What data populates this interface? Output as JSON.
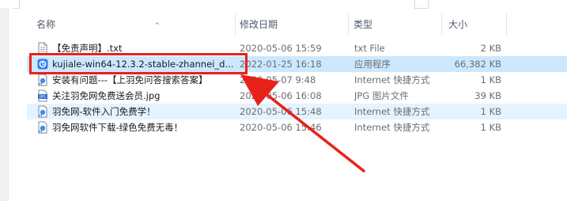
{
  "header": {
    "name": "名称",
    "date": "修改日期",
    "type": "类型",
    "size": "大小"
  },
  "files": [
    {
      "name": "【免责声明】.txt",
      "date": "2020-05-06 15:59",
      "type": "txt File",
      "size": "2 KB",
      "icon": "text-file-icon"
    },
    {
      "name": "kujiale-win64-12.3.2-stable-zhannei_d...",
      "date": "2022-01-25 16:18",
      "type": "应用程序",
      "size": "66,382 KB",
      "icon": "app-exe-icon"
    },
    {
      "name": "安装有问题---【上羽免问答搜索答案】",
      "date": "2020-05-07 9:48",
      "type": "Internet 快捷方式",
      "size": "1 KB",
      "icon": "internet-shortcut-icon"
    },
    {
      "name": "关注羽免网免费送会员.jpg",
      "date": "2020-05-06 16:08",
      "type": "JPG 图片文件",
      "size": "39 KB",
      "icon": "jpg-image-icon"
    },
    {
      "name": "羽免网-软件入门免费学！",
      "date": "2020-05-06 15:48",
      "type": "Internet 快捷方式",
      "size": "1 KB",
      "icon": "internet-shortcut-icon"
    },
    {
      "name": "羽免网软件下载-绿色免费无毒！",
      "date": "2020-05-06 15:46",
      "type": "Internet 快捷方式",
      "size": "1 KB",
      "icon": "internet-shortcut-icon"
    }
  ],
  "colors": {
    "annotation": "#e8211b",
    "selection": "#cce8ff",
    "hover": "#e5f3ff"
  }
}
